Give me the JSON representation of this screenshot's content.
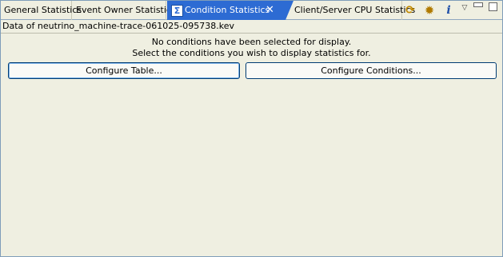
{
  "tabs": [
    {
      "label": "General Statistics"
    },
    {
      "label": "Event Owner Statistics"
    },
    {
      "label": "Condition Statistics",
      "active": true,
      "icon": "sigma-icon"
    },
    {
      "label": "Client/Server CPU Statistics"
    }
  ],
  "toolbar": {
    "icons": [
      "refresh-icon",
      "gear-icon",
      "info-icon",
      "view-menu-icon",
      "minimize-icon",
      "maximize-icon"
    ]
  },
  "content": {
    "data_title": "Data of neutrino_machine-trace-061025-095738.kev",
    "message_line1": "No conditions have been selected for display.",
    "message_line2": "Select the conditions you wish to display statistics for.",
    "configure_table_label": "Configure Table...",
    "configure_conditions_label": "Configure Conditions..."
  },
  "colors": {
    "active_tab": "#2d6bd3",
    "background": "#efefe1",
    "border": "#7f9db9"
  }
}
